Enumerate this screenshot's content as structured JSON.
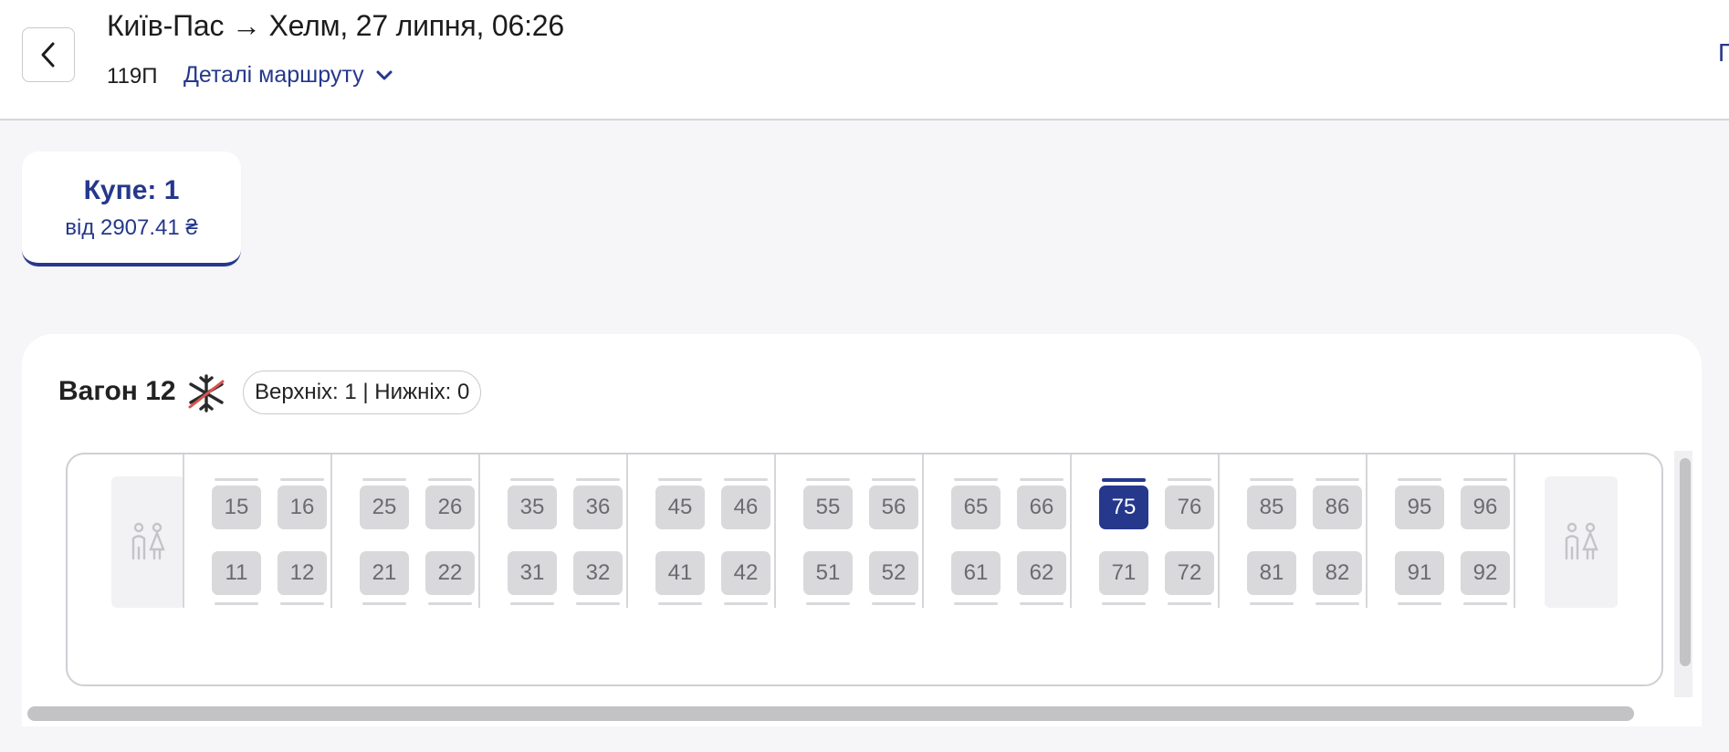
{
  "header": {
    "title": "Київ-Пас → Хелм, 27 липня, 06:26",
    "train_number": "119П",
    "route_details_label": "Деталі маршруту",
    "edge_text": "П"
  },
  "class_tab": {
    "name": "Купе: 1",
    "price": "від 2907.41 ₴"
  },
  "car": {
    "title": "Вагон 12",
    "counts": "Верхніх: 1 | Нижніх: 0",
    "icons": [
      "no-air-conditioning-icon",
      "toilet-icon"
    ],
    "selected_seat": "75",
    "compartments": [
      {
        "upper": [
          "15",
          "16"
        ],
        "lower": [
          "11",
          "12"
        ]
      },
      {
        "upper": [
          "25",
          "26"
        ],
        "lower": [
          "21",
          "22"
        ]
      },
      {
        "upper": [
          "35",
          "36"
        ],
        "lower": [
          "31",
          "32"
        ]
      },
      {
        "upper": [
          "45",
          "46"
        ],
        "lower": [
          "41",
          "42"
        ]
      },
      {
        "upper": [
          "55",
          "56"
        ],
        "lower": [
          "51",
          "52"
        ]
      },
      {
        "upper": [
          "65",
          "66"
        ],
        "lower": [
          "61",
          "62"
        ]
      },
      {
        "upper": [
          "75",
          "76"
        ],
        "lower": [
          "71",
          "72"
        ]
      },
      {
        "upper": [
          "85",
          "86"
        ],
        "lower": [
          "81",
          "82"
        ]
      },
      {
        "upper": [
          "95",
          "96"
        ],
        "lower": [
          "91",
          "92"
        ]
      }
    ]
  },
  "colors": {
    "accent": "#25388c",
    "seat_unavailable": "#d9d9dc",
    "seat_text": "#6a6a70",
    "background": "#f6f6f8"
  }
}
